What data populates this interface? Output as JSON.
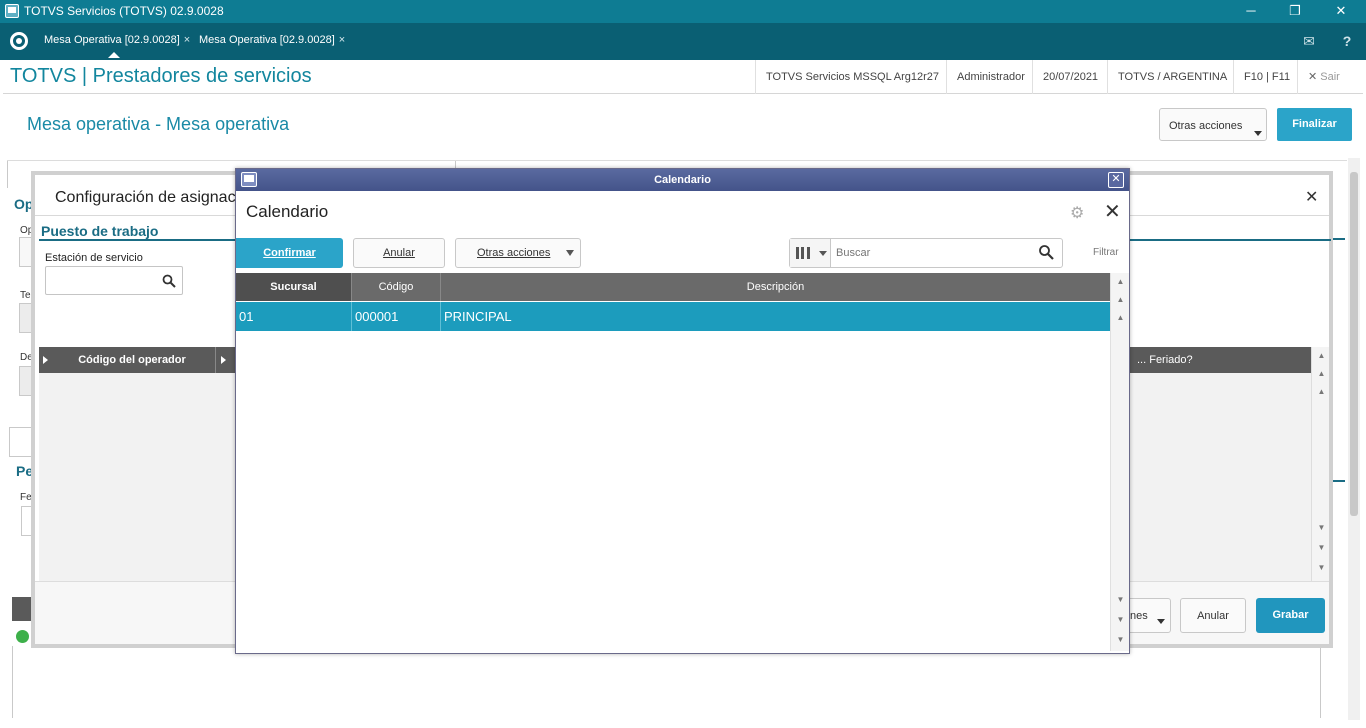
{
  "window": {
    "title": "TOTVS Servicios (TOTVS) 02.9.0028",
    "min": "─",
    "restore": "❐",
    "close": "✕"
  },
  "tabs": [
    {
      "label": "Mesa Operativa [02.9.0028]",
      "close": "×"
    },
    {
      "label": "Mesa Operativa [02.9.0028]",
      "close": "×"
    }
  ],
  "icons": {
    "mail": "✉",
    "help": "?"
  },
  "app": {
    "title": "TOTVS | Prestadores de servicios",
    "info": {
      "server": "TOTVS Servicios MSSQL Arg12r27",
      "user": "Administrador",
      "date": "20/07/2021",
      "company": "TOTVS / ARGENTINA",
      "keys": "F10 | F11",
      "exit": "Sair",
      "exit_icon": "✕"
    }
  },
  "page": {
    "title": "Mesa operativa - Mesa operativa",
    "otras_acciones": "Otras acciones",
    "finalizar": "Finalizar"
  },
  "background_labels": {
    "op": "Op",
    "op_field": "Op",
    "te": "Te",
    "de": "De",
    "pe": "Pe",
    "fe": "Fe"
  },
  "config": {
    "title": "Configuración de asignación",
    "close": "✕",
    "section": "Puesto de trabajo",
    "estacion_label": "Estación de servicio",
    "grid_col_operador": "Código del operador",
    "grid_col_feriado": "... Feriado?",
    "acciones_partial": "nes",
    "anular": "Anular",
    "grabar": "Grabar"
  },
  "calendario": {
    "window_title": "Calendario",
    "title": "Calendario",
    "close": "✕",
    "gear": "⚙",
    "confirmar": "Confirmar",
    "anular": "Anular",
    "otras_acciones": "Otras acciones",
    "search_placeholder": "Buscar",
    "filtrar": "Filtrar",
    "columns": [
      "Sucursal",
      "Código",
      "Descripción"
    ],
    "rows": [
      {
        "sucursal": "01",
        "codigo": "000001",
        "descripcion": "PRINCIPAL"
      }
    ]
  }
}
